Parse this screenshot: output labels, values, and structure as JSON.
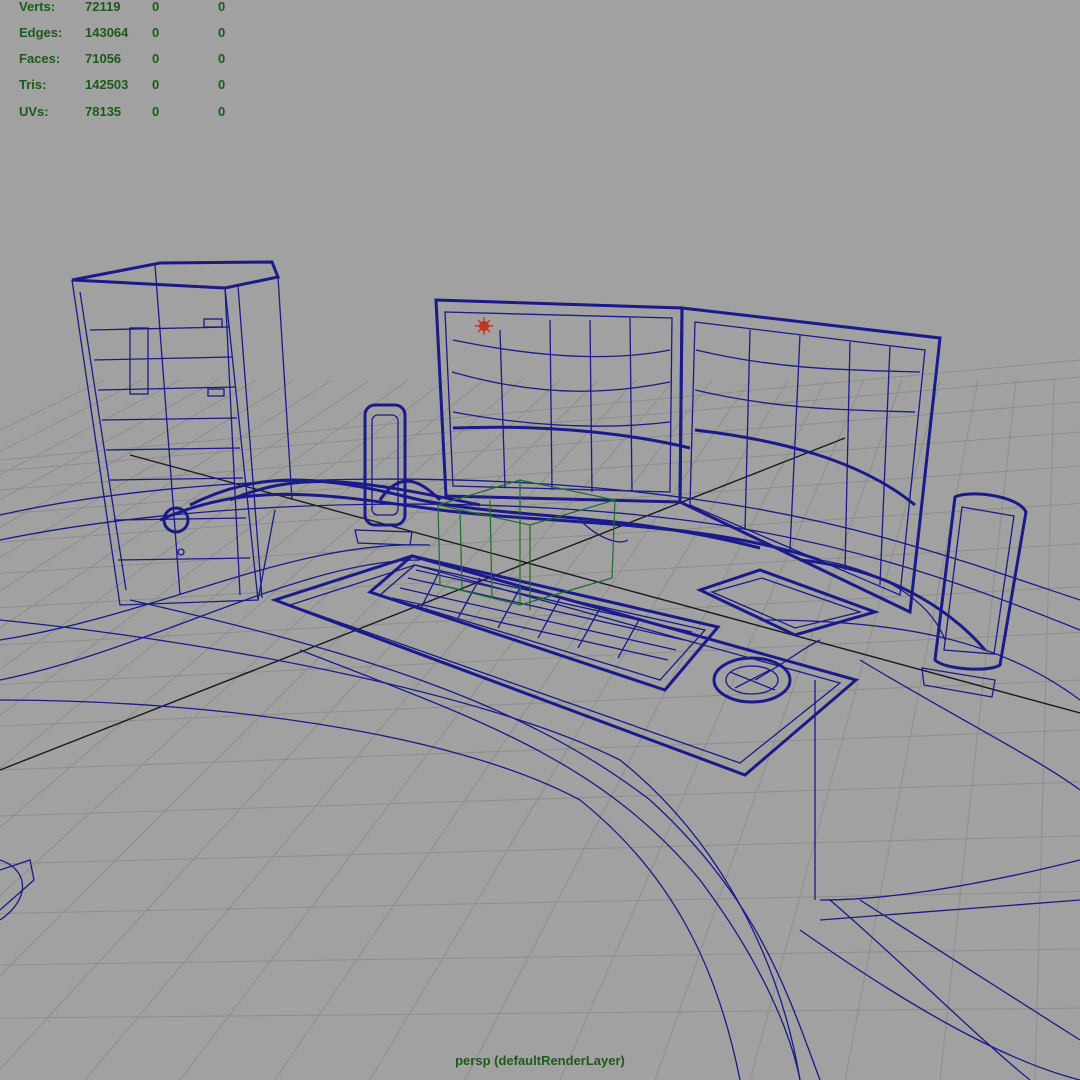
{
  "hud": {
    "rows": [
      {
        "label": "Verts:",
        "v1": "72119",
        "v2": "0",
        "v3": "0"
      },
      {
        "label": "Edges:",
        "v1": "143064",
        "v2": "0",
        "v3": "0"
      },
      {
        "label": "Faces:",
        "v1": "71056",
        "v2": "0",
        "v3": "0"
      },
      {
        "label": "Tris:",
        "v1": "142503",
        "v2": "0",
        "v3": "0"
      },
      {
        "label": "UVs:",
        "v1": "78135",
        "v2": "0",
        "v3": "0"
      }
    ]
  },
  "camera_label": "persp (defaultRenderLayer)",
  "colors": {
    "background": "#a1a1a1",
    "wireframe": "#1a1a8a",
    "hud_text": "#1a5c1a",
    "grid": "#8d8d8d",
    "selection": "#1f6e2a",
    "light_icon": "#c0391b"
  },
  "scene_objects": [
    "pc-tower",
    "monitor-left",
    "monitor-right",
    "speaker-left",
    "speaker-right",
    "keyboard",
    "keyboard-tray",
    "mouse",
    "mousepad",
    "cables",
    "desk",
    "point-light"
  ]
}
